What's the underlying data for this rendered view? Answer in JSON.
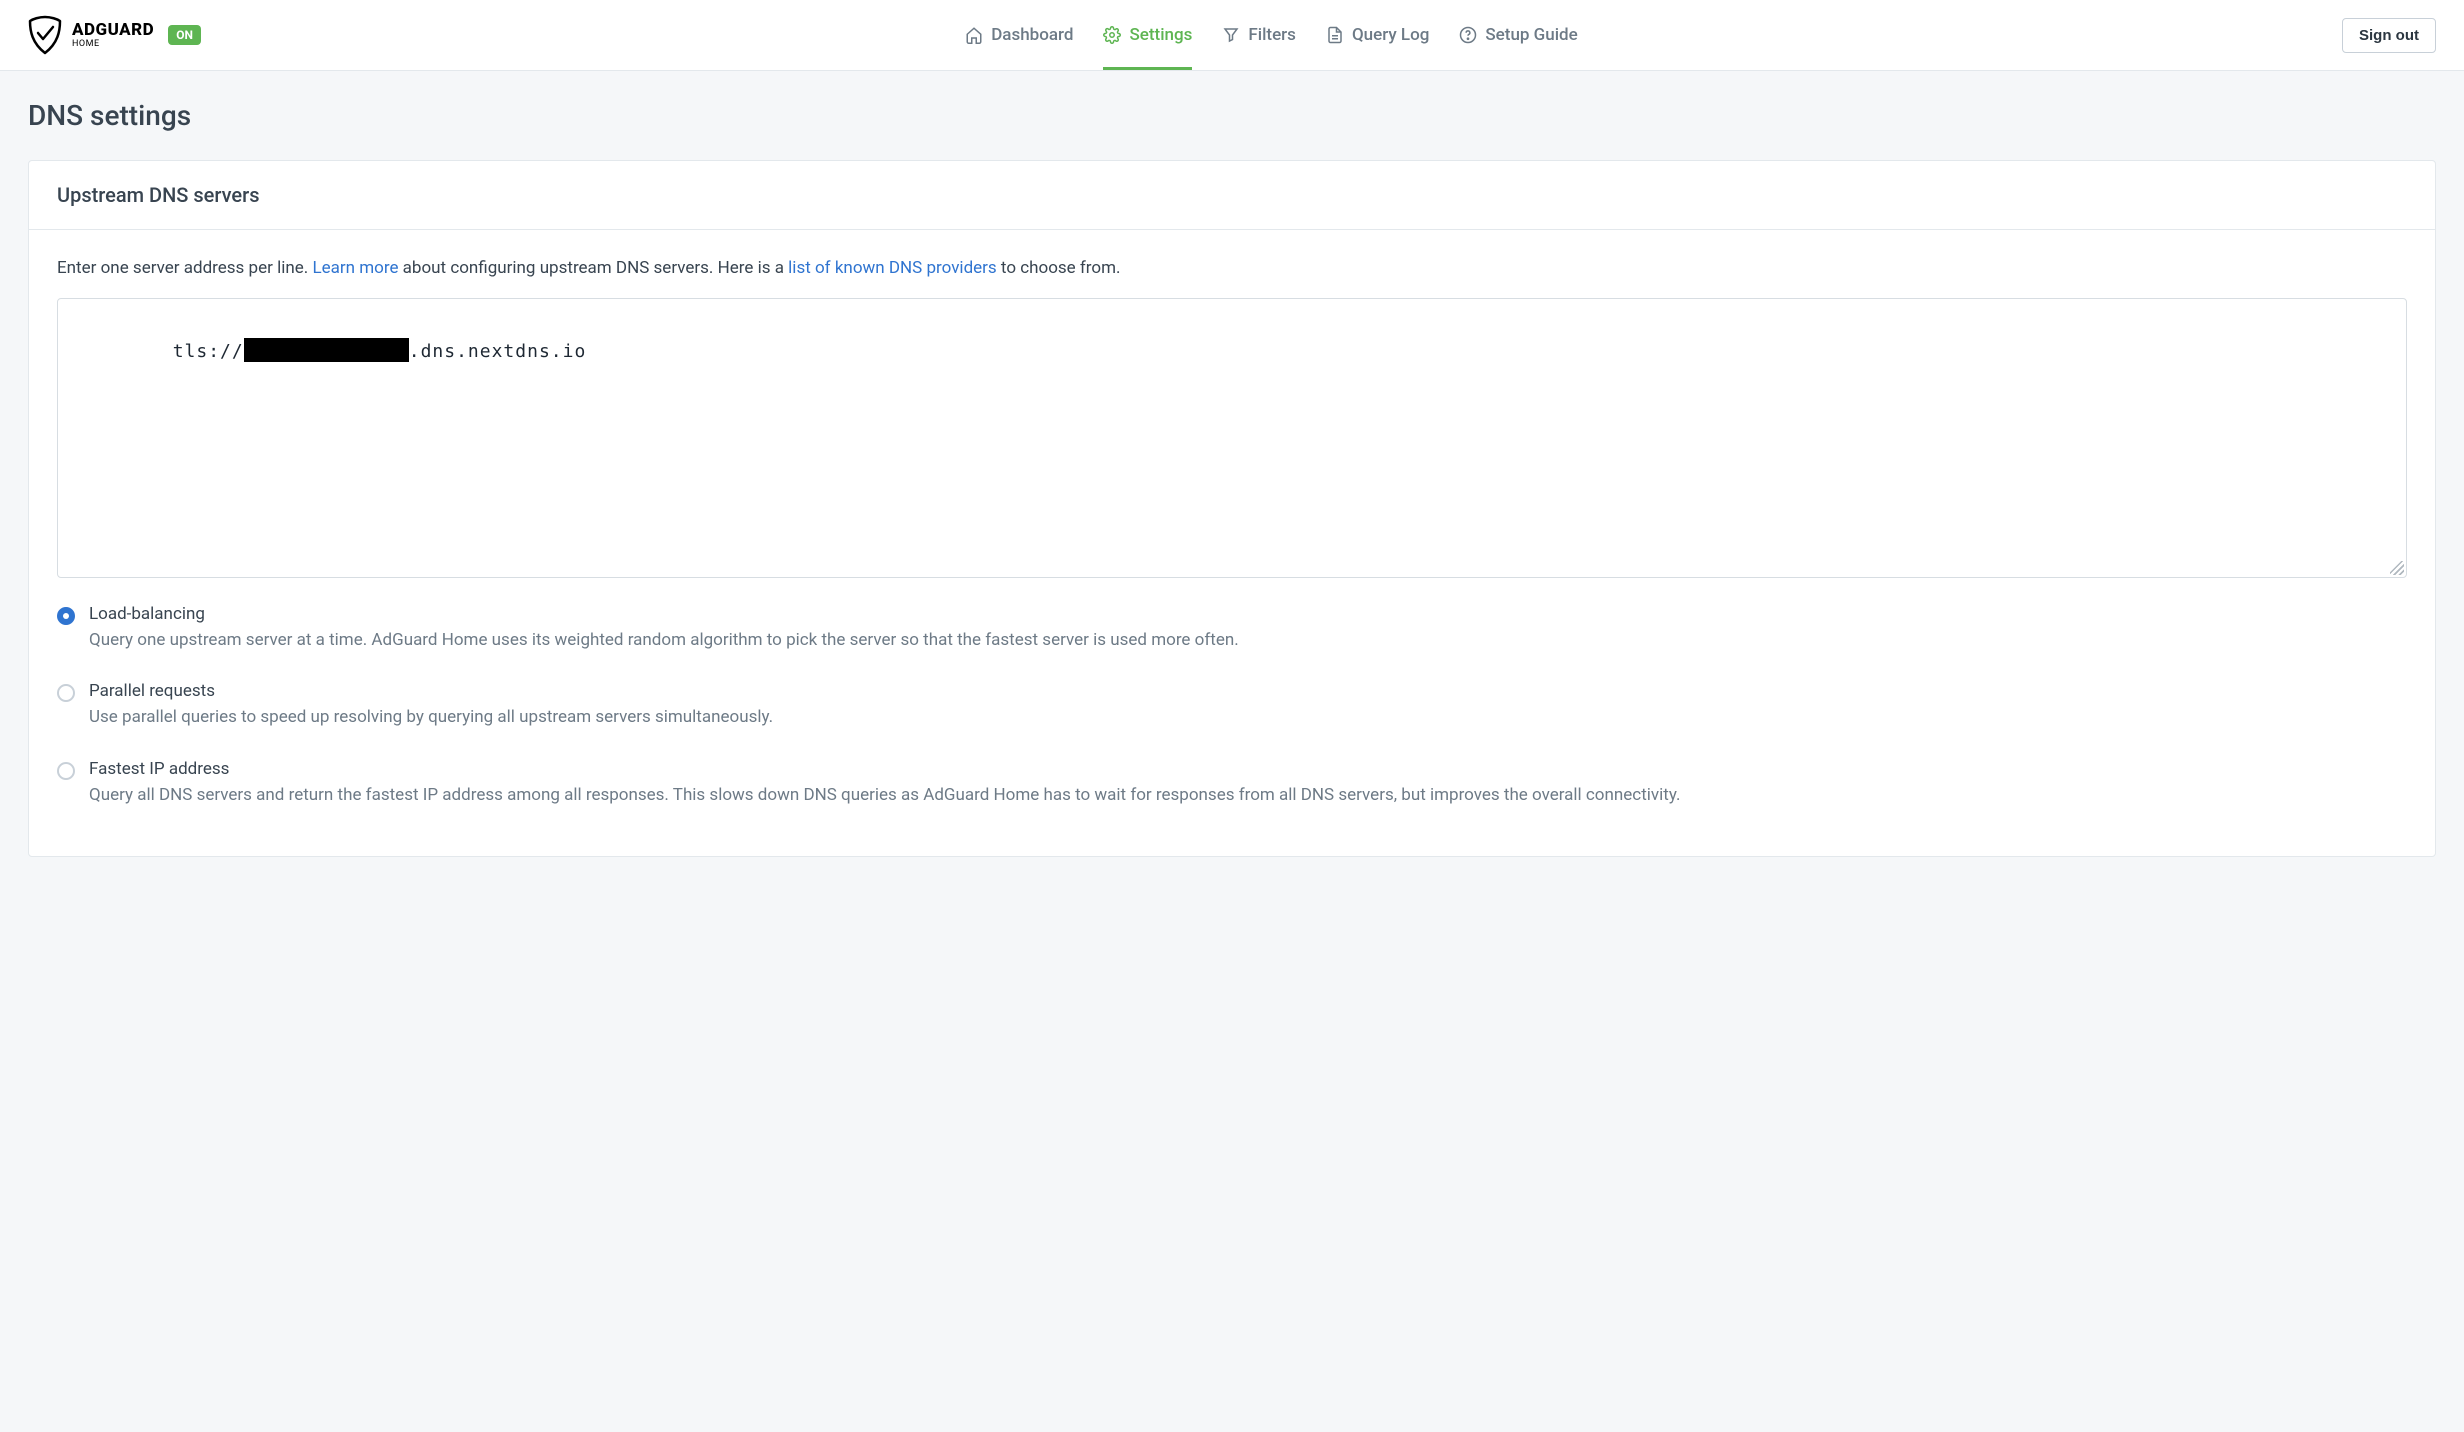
{
  "brand": {
    "title": "ADGUARD",
    "subtitle": "HOME",
    "status": "ON"
  },
  "nav": {
    "dashboard": "Dashboard",
    "settings": "Settings",
    "filters": "Filters",
    "querylog": "Query Log",
    "setupguide": "Setup Guide"
  },
  "signout": "Sign out",
  "page": {
    "title": "DNS settings"
  },
  "upstream": {
    "card_title": "Upstream DNS servers",
    "help_pre": "Enter one server address per line. ",
    "learn_more": "Learn more",
    "help_mid": " about configuring upstream DNS servers. Here is a ",
    "providers_link": "list of known DNS providers",
    "help_post": " to choose from.",
    "server_prefix": "tls://",
    "server_redacted": true,
    "server_suffix": ".dns.nextdns.io",
    "servers_value": "tls://[REDACTED].dns.nextdns.io"
  },
  "modes": {
    "load_balancing": {
      "title": "Load-balancing",
      "desc": "Query one upstream server at a time. AdGuard Home uses its weighted random algorithm to pick the server so that the fastest server is used more often.",
      "selected": true
    },
    "parallel": {
      "title": "Parallel requests",
      "desc": "Use parallel queries to speed up resolving by querying all upstream servers simultaneously.",
      "selected": false
    },
    "fastest": {
      "title": "Fastest IP address",
      "desc": "Query all DNS servers and return the fastest IP address among all responses. This slows down DNS queries as AdGuard Home has to wait for responses from all DNS servers, but improves the overall connectivity.",
      "selected": false
    }
  }
}
